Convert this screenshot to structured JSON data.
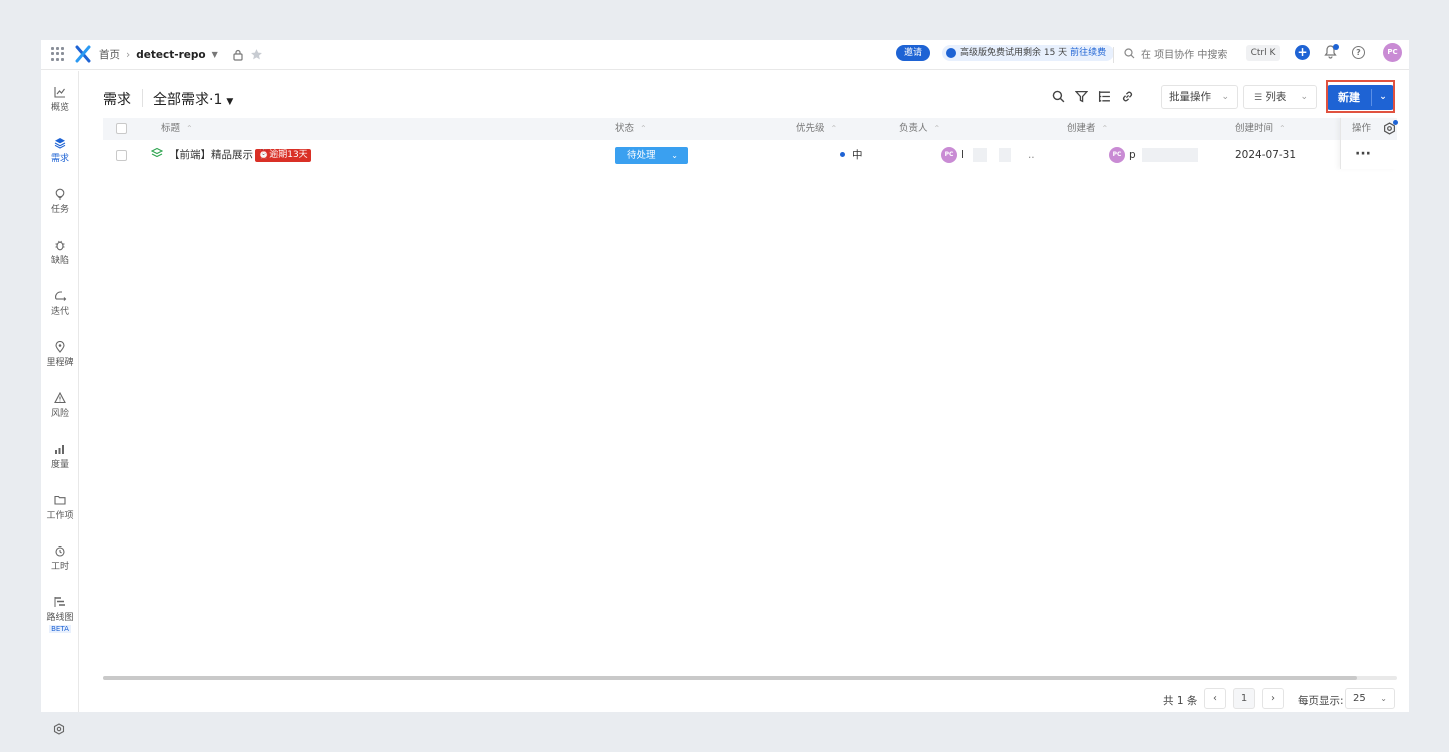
{
  "topbar": {
    "home": "首页",
    "repo": "detect-repo",
    "invite": "邀请",
    "trial_text": "高级版免费试用剩余 15 天",
    "trial_link": "前往续费",
    "search": "在 项目协作 中搜索",
    "shortcut": "Ctrl K",
    "avatar": "PC"
  },
  "sidebar": {
    "items": [
      {
        "label": "概览",
        "icon": "chart-line-icon"
      },
      {
        "label": "需求",
        "icon": "layers-icon"
      },
      {
        "label": "任务",
        "icon": "bulb-icon"
      },
      {
        "label": "缺陷",
        "icon": "bug-icon"
      },
      {
        "label": "迭代",
        "icon": "cycle-icon"
      },
      {
        "label": "里程碑",
        "icon": "pin-icon"
      },
      {
        "label": "风险",
        "icon": "warning-icon"
      },
      {
        "label": "度量",
        "icon": "bars-icon"
      },
      {
        "label": "工作项",
        "icon": "folder-icon"
      },
      {
        "label": "工时",
        "icon": "timer-icon"
      },
      {
        "label": "路线图",
        "icon": "roadmap-icon"
      }
    ],
    "beta": "BETA"
  },
  "header": {
    "title": "需求",
    "view_name": "全部需求·1",
    "batch": "批量操作",
    "list": "列表",
    "new": "新建"
  },
  "table": {
    "columns": {
      "title": "标题",
      "status": "状态",
      "priority": "优先级",
      "assignee": "负责人",
      "creator": "创建者",
      "created": "创建时间",
      "actions": "操作"
    },
    "rows": [
      {
        "title": "【前端】精品展示",
        "overdue": "逾期13天",
        "status": "待处理",
        "priority": "中",
        "assignee_avatar": "PC",
        "assignee": "l",
        "assignee_tail": "..",
        "creator_avatar": "PC",
        "creator": "p",
        "created": "2024-07-31",
        "more": "···"
      }
    ]
  },
  "footer": {
    "total": "共 1 条",
    "page": "1",
    "per_page_label": "每页显示:",
    "per_page": "25"
  },
  "colors": {
    "accent": "#1e63d4",
    "status": "#3aa0f0",
    "overdue": "#d93026",
    "avatar": "#c98bd4",
    "highlight": "#e0523f"
  }
}
